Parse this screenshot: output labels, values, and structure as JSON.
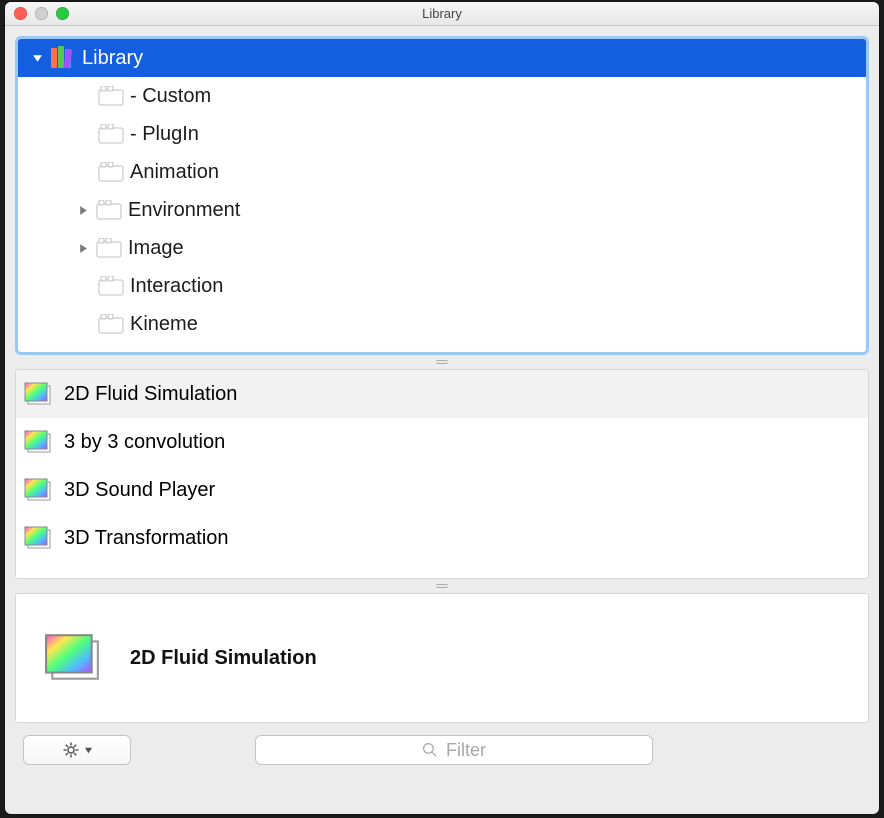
{
  "window": {
    "title": "Library"
  },
  "tree": {
    "root": "Library",
    "items": [
      {
        "label": "- Custom",
        "expandable": false
      },
      {
        "label": "- PlugIn",
        "expandable": false
      },
      {
        "label": "Animation",
        "expandable": false
      },
      {
        "label": "Environment",
        "expandable": true
      },
      {
        "label": "Image",
        "expandable": true
      },
      {
        "label": "Interaction",
        "expandable": false
      },
      {
        "label": "Kineme",
        "expandable": false
      }
    ]
  },
  "list": {
    "items": [
      {
        "label": "2D Fluid Simulation",
        "selected": true
      },
      {
        "label": "3 by 3 convolution",
        "selected": false
      },
      {
        "label": "3D Sound Player",
        "selected": false
      },
      {
        "label": "3D Transformation",
        "selected": false
      }
    ]
  },
  "detail": {
    "title": "2D Fluid Simulation"
  },
  "search": {
    "placeholder": "Filter"
  }
}
